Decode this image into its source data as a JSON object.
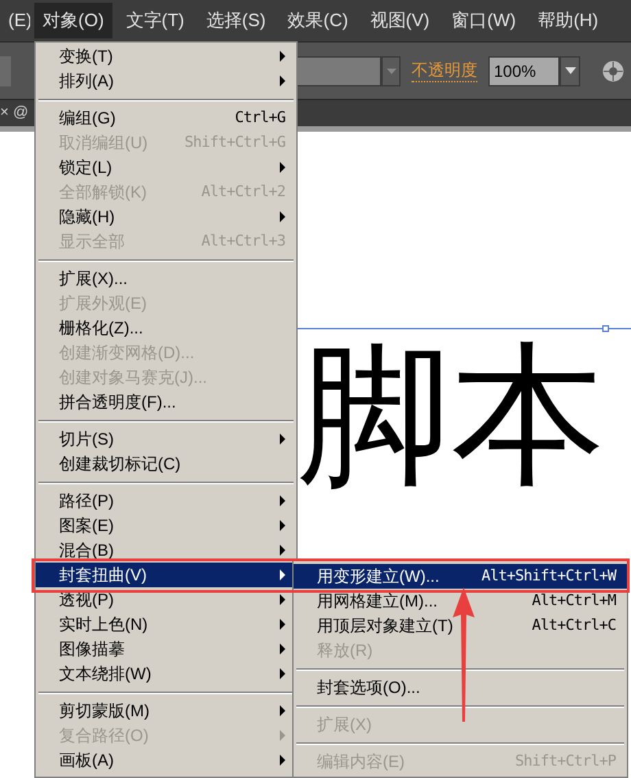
{
  "menu_bar": [
    {
      "label": "(E)",
      "selected": false
    },
    {
      "label": "对象(O)",
      "selected": true
    },
    {
      "label": "文字(T)",
      "selected": false
    },
    {
      "label": "选择(S)",
      "selected": false
    },
    {
      "label": "效果(C)",
      "selected": false
    },
    {
      "label": "视图(V)",
      "selected": false
    },
    {
      "label": "窗口(W)",
      "selected": false
    },
    {
      "label": "帮助(H)",
      "selected": false
    }
  ],
  "toolbar": {
    "opacity_label": "不透明度",
    "opacity_value": "100%"
  },
  "document_tab": "× @",
  "canvas_text": "脚本",
  "menu": [
    {
      "kind": "item",
      "label": "变换(T)",
      "submenu": true,
      "disabled": false,
      "selected": false
    },
    {
      "kind": "item",
      "label": "排列(A)",
      "submenu": true,
      "disabled": false,
      "selected": false
    },
    {
      "kind": "separator"
    },
    {
      "kind": "item",
      "label": "编组(G)",
      "shortcut": "Ctrl+G",
      "disabled": false,
      "selected": false
    },
    {
      "kind": "item",
      "label": "取消编组(U)",
      "shortcut": "Shift+Ctrl+G",
      "disabled": true,
      "selected": false
    },
    {
      "kind": "item",
      "label": "锁定(L)",
      "submenu": true,
      "disabled": false,
      "selected": false
    },
    {
      "kind": "item",
      "label": "全部解锁(K)",
      "shortcut": "Alt+Ctrl+2",
      "disabled": true,
      "selected": false
    },
    {
      "kind": "item",
      "label": "隐藏(H)",
      "submenu": true,
      "disabled": false,
      "selected": false
    },
    {
      "kind": "item",
      "label": "显示全部",
      "shortcut": "Alt+Ctrl+3",
      "disabled": true,
      "selected": false
    },
    {
      "kind": "separator"
    },
    {
      "kind": "item",
      "label": "扩展(X)...",
      "disabled": false,
      "selected": false
    },
    {
      "kind": "item",
      "label": "扩展外观(E)",
      "disabled": true,
      "selected": false
    },
    {
      "kind": "item",
      "label": "栅格化(Z)...",
      "disabled": false,
      "selected": false
    },
    {
      "kind": "item",
      "label": "创建渐变网格(D)...",
      "disabled": true,
      "selected": false
    },
    {
      "kind": "item",
      "label": "创建对象马赛克(J)...",
      "disabled": true,
      "selected": false
    },
    {
      "kind": "item",
      "label": "拼合透明度(F)...",
      "disabled": false,
      "selected": false
    },
    {
      "kind": "separator"
    },
    {
      "kind": "item",
      "label": "切片(S)",
      "submenu": true,
      "disabled": false,
      "selected": false
    },
    {
      "kind": "item",
      "label": "创建裁切标记(C)",
      "disabled": false,
      "selected": false
    },
    {
      "kind": "separator"
    },
    {
      "kind": "item",
      "label": "路径(P)",
      "submenu": true,
      "disabled": false,
      "selected": false
    },
    {
      "kind": "item",
      "label": "图案(E)",
      "submenu": true,
      "disabled": false,
      "selected": false
    },
    {
      "kind": "item",
      "label": "混合(B)",
      "submenu": true,
      "disabled": false,
      "selected": false
    },
    {
      "kind": "item",
      "label": "封套扭曲(V)",
      "submenu": true,
      "disabled": false,
      "selected": true
    },
    {
      "kind": "item",
      "label": "透视(P)",
      "submenu": true,
      "disabled": false,
      "selected": false
    },
    {
      "kind": "item",
      "label": "实时上色(N)",
      "submenu": true,
      "disabled": false,
      "selected": false
    },
    {
      "kind": "item",
      "label": "图像描摹",
      "submenu": true,
      "disabled": false,
      "selected": false
    },
    {
      "kind": "item",
      "label": "文本绕排(W)",
      "submenu": true,
      "disabled": false,
      "selected": false
    },
    {
      "kind": "separator"
    },
    {
      "kind": "item",
      "label": "剪切蒙版(M)",
      "submenu": true,
      "disabled": false,
      "selected": false
    },
    {
      "kind": "item",
      "label": "复合路径(O)",
      "submenu": true,
      "disabled": true,
      "selected": false
    },
    {
      "kind": "item",
      "label": "画板(A)",
      "submenu": true,
      "disabled": false,
      "selected": false
    }
  ],
  "submenu": [
    {
      "kind": "item",
      "label": "用变形建立(W)...",
      "shortcut": "Alt+Shift+Ctrl+W",
      "disabled": false,
      "selected": true
    },
    {
      "kind": "item",
      "label": "用网格建立(M)...",
      "shortcut": "Alt+Ctrl+M",
      "disabled": false,
      "selected": false
    },
    {
      "kind": "item",
      "label": "用顶层对象建立(T)",
      "shortcut": "Alt+Ctrl+C",
      "disabled": false,
      "selected": false
    },
    {
      "kind": "item",
      "label": "释放(R)",
      "disabled": true,
      "selected": false
    },
    {
      "kind": "separator"
    },
    {
      "kind": "item",
      "label": "封套选项(O)...",
      "disabled": false,
      "selected": false
    },
    {
      "kind": "separator"
    },
    {
      "kind": "item",
      "label": "扩展(X)",
      "disabled": true,
      "selected": false
    },
    {
      "kind": "separator"
    },
    {
      "kind": "item",
      "label": "编辑内容(E)",
      "shortcut": "Shift+Ctrl+P",
      "disabled": true,
      "selected": false
    }
  ]
}
